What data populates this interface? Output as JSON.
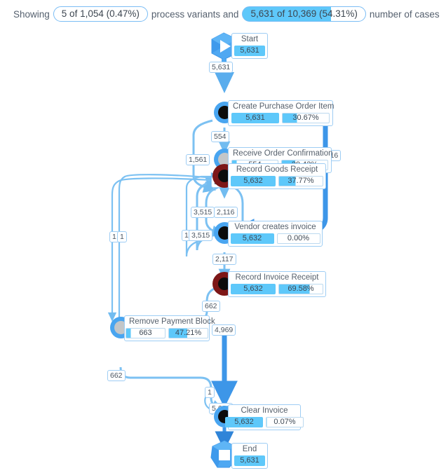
{
  "header": {
    "prefix": "Showing",
    "variants_pill": "5 of 1,054 (0.47%)",
    "middle": "process variants and",
    "cases_pill": "5,631 of 10,369 (54.31%)",
    "suffix": "number of cases",
    "cases_pill_fill_pct": 72
  },
  "colors": {
    "accent_blue": "#49a5f0",
    "edge_blue": "#7cc1f2",
    "edge_blue_strong": "#3d96e8",
    "dark_red": "#7d1717",
    "node_black": "#0c0c0c",
    "node_gray": "#c3c6c8",
    "pill_fill": "#5ec8fa",
    "label_border": "#9ecdf4",
    "text": "#56606c"
  },
  "nodes": [
    {
      "id": "start",
      "kind": "start-event",
      "label": "Start",
      "count": "5,631",
      "count_fill_pct": 100,
      "pct": null,
      "icon": "play-icon"
    },
    {
      "id": "create-purchase-order-item",
      "kind": "activity",
      "label": "Create Purchase Order Item",
      "count": "5,631",
      "count_fill_pct": 100,
      "pct": "30.67%",
      "pct_fill_pct": 31,
      "ring": "blue",
      "core": "black"
    },
    {
      "id": "receive-order-confirmation",
      "kind": "activity",
      "label": "Receive Order Confirmation",
      "count": "554",
      "count_fill_pct": 10,
      "pct": "29.42%",
      "pct_fill_pct": 29,
      "ring": "blue",
      "core": "gray"
    },
    {
      "id": "record-goods-receipt",
      "kind": "activity",
      "label": "Record Goods Receipt",
      "count": "5,632",
      "count_fill_pct": 100,
      "pct": "37.77%",
      "pct_fill_pct": 38,
      "ring": "red",
      "core": "black"
    },
    {
      "id": "vendor-creates-invoice",
      "kind": "activity",
      "label": "Vendor creates invoice",
      "count": "5,632",
      "count_fill_pct": 100,
      "pct": "0.00%",
      "pct_fill_pct": 0,
      "ring": "blue",
      "core": "black"
    },
    {
      "id": "record-invoice-receipt",
      "kind": "activity",
      "label": "Record Invoice Receipt",
      "count": "5,632",
      "count_fill_pct": 100,
      "pct": "69.58%",
      "pct_fill_pct": 70,
      "ring": "red",
      "core": "black"
    },
    {
      "id": "remove-payment-block",
      "kind": "activity",
      "label": "Remove Payment Block",
      "count": "663",
      "count_fill_pct": 12,
      "pct": "47.21%",
      "pct_fill_pct": 47,
      "ring": "blue",
      "core": "gray"
    },
    {
      "id": "clear-invoice",
      "kind": "activity",
      "label": "Clear Invoice",
      "count": "5,632",
      "count_fill_pct": 100,
      "pct": "0.07%",
      "pct_fill_pct": 1,
      "ring": "blue",
      "core": "black"
    },
    {
      "id": "end",
      "kind": "end-event",
      "label": "End",
      "count": "5,631",
      "count_fill_pct": 100,
      "pct": null,
      "icon": "stop-icon"
    }
  ],
  "edges": [
    {
      "id": "start-to-create",
      "from": "start",
      "to": "create-purchase-order-item",
      "count": "5,631"
    },
    {
      "id": "create-to-receive",
      "from": "create-purchase-order-item",
      "to": "receive-order-confirmation",
      "count": "554"
    },
    {
      "id": "create-to-goods",
      "from": "create-purchase-order-item",
      "to": "record-goods-receipt",
      "count": "1,561"
    },
    {
      "id": "receive-to-goods",
      "from": "receive-order-confirmation",
      "to": "record-goods-receipt",
      "count": "554"
    },
    {
      "id": "create-to-vendor",
      "from": "create-purchase-order-item",
      "to": "vendor-creates-invoice",
      "count": "3,516"
    },
    {
      "id": "goods-to-vendor-a",
      "from": "record-goods-receipt",
      "to": "vendor-creates-invoice",
      "count": "3,515"
    },
    {
      "id": "goods-to-vendor-b",
      "from": "record-goods-receipt",
      "to": "vendor-creates-invoice",
      "count": "2,116"
    },
    {
      "id": "vendor-to-goods-a",
      "from": "vendor-creates-invoice",
      "to": "record-goods-receipt",
      "count": "1"
    },
    {
      "id": "vendor-to-goods-b",
      "from": "vendor-creates-invoice",
      "to": "record-goods-receipt",
      "count": "3,515"
    },
    {
      "id": "vendor-to-invoice",
      "from": "vendor-creates-invoice",
      "to": "record-invoice-receipt",
      "count": "2,117"
    },
    {
      "id": "goods-to-remove",
      "from": "record-goods-receipt",
      "to": "remove-payment-block",
      "count": "1"
    },
    {
      "id": "invoice-to-remove-left",
      "from": "record-invoice-receipt",
      "to": "remove-payment-block",
      "count": "1"
    },
    {
      "id": "invoice-to-remove",
      "from": "record-invoice-receipt",
      "to": "remove-payment-block",
      "count": "662"
    },
    {
      "id": "invoice-to-clear",
      "from": "record-invoice-receipt",
      "to": "clear-invoice",
      "count": "4,969"
    },
    {
      "id": "remove-to-clear",
      "from": "remove-payment-block",
      "to": "clear-invoice",
      "count": "662"
    },
    {
      "id": "remove-to-clear-thin",
      "from": "remove-payment-block",
      "to": "clear-invoice",
      "count": "1"
    },
    {
      "id": "clear-to-end",
      "from": "clear-invoice",
      "to": "end",
      "count": "5,631"
    }
  ]
}
